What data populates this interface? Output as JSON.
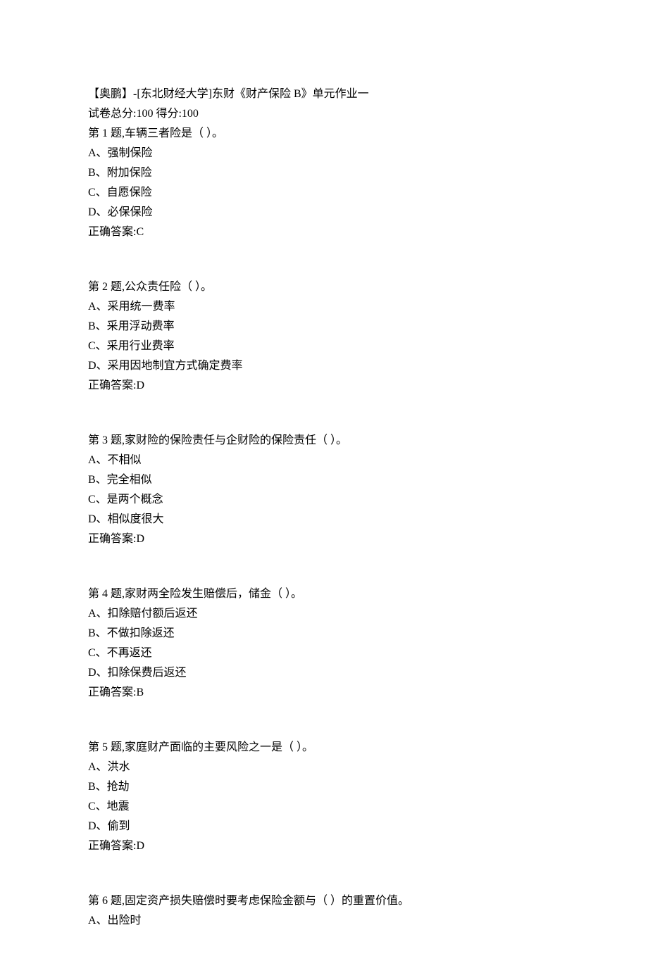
{
  "header": {
    "title": "【奥鹏】-[东北财经大学]东财《财产保险 B》单元作业一",
    "scoreline": "试卷总分:100     得分:100"
  },
  "questions": [
    {
      "prompt": "第 1 题,车辆三者险是（ ）。",
      "options": [
        "A、强制保险",
        "B、附加保险",
        "C、自愿保险",
        "D、必保保险"
      ],
      "answer": "正确答案:C"
    },
    {
      "prompt": "第 2 题,公众责任险（ ）。",
      "options": [
        "A、采用统一费率",
        "B、采用浮动费率",
        "C、采用行业费率",
        "D、采用因地制宜方式确定费率"
      ],
      "answer": "正确答案:D"
    },
    {
      "prompt": "第 3 题,家财险的保险责任与企财险的保险责任（ ）。",
      "options": [
        "A、不相似",
        "B、完全相似",
        "C、是两个概念",
        "D、相似度很大"
      ],
      "answer": "正确答案:D"
    },
    {
      "prompt": "第 4 题,家财两全险发生赔偿后，储金（ ）。",
      "options": [
        "A、扣除赔付额后返还",
        "B、不做扣除返还",
        "C、不再返还",
        "D、扣除保费后返还"
      ],
      "answer": "正确答案:B"
    },
    {
      "prompt": "第 5 题,家庭财产面临的主要风险之一是（ ）。",
      "options": [
        "A、洪水",
        "B、抢劫",
        "C、地震",
        "D、偷到"
      ],
      "answer": "正确答案:D"
    },
    {
      "prompt": "第 6 题,固定资产损失赔偿时要考虑保险金额与（ ）的重置价值。",
      "options": [
        "A、出险时"
      ],
      "answer": ""
    }
  ]
}
